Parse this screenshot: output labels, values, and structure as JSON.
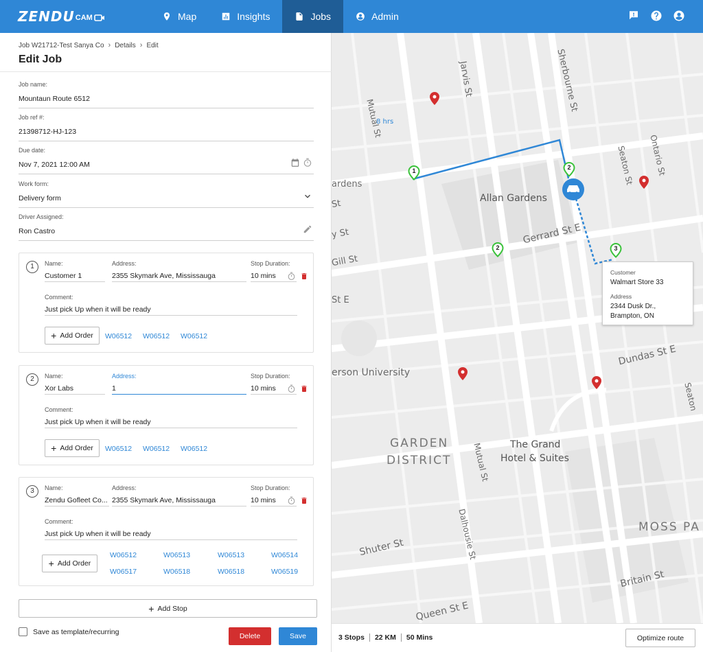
{
  "header": {
    "brand": "ZENDU",
    "brand_suffix": "CAM",
    "nav": [
      {
        "label": "Map",
        "icon": "map-pin-icon"
      },
      {
        "label": "Insights",
        "icon": "bar-chart-icon"
      },
      {
        "label": "Jobs",
        "icon": "document-icon",
        "active": true
      },
      {
        "label": "Admin",
        "icon": "user-circle-icon"
      }
    ],
    "accent": "#2f87d6",
    "active_bg": "#1f5d96"
  },
  "breadcrumb": [
    "Job W21712-Test Sanya Co",
    "Details",
    "Edit"
  ],
  "page_title": "Edit Job",
  "form": {
    "job_name": {
      "label": "Job name:",
      "value": "Mountaun Route 6512"
    },
    "job_ref": {
      "label": "Job ref #:",
      "value": "21398712-HJ-123"
    },
    "due_date": {
      "label": "Due date:",
      "value": "Nov 7, 2021 12:00 AM"
    },
    "work_form": {
      "label": "Work form:",
      "value": "Delivery form"
    },
    "driver": {
      "label": "Driver Assigned:",
      "value": "Ron Castro"
    }
  },
  "stop_labels": {
    "name": "Name:",
    "address": "Address:",
    "duration": "Stop Duration:",
    "comment": "Comment:",
    "add_order": "Add Order"
  },
  "stops": [
    {
      "num": "1",
      "name": "Customer 1",
      "address": "2355 Skymark Ave, Mississauga",
      "duration": "10 mins",
      "comment": "Just pick Up when it will be ready",
      "orders": [
        "W06512",
        "W06512",
        "W06512"
      ]
    },
    {
      "num": "2",
      "name": "Xor Labs",
      "address": "1",
      "duration": "10 mins",
      "comment": "Just pick Up when it will be ready",
      "orders": [
        "W06512",
        "W06512",
        "W06512"
      ]
    },
    {
      "num": "3",
      "name": "Zendu Gofleet Co...",
      "address": "2355 Skymark Ave, Mississauga",
      "duration": "10 mins",
      "comment": "Just pick Up when it will be ready",
      "orders": [
        "W06512",
        "W06513",
        "W06513",
        "W06514",
        "W06517",
        "W06518",
        "W06518",
        "W06519"
      ]
    }
  ],
  "actions": {
    "add_stop": "Add Stop",
    "template": "Save as template/recurring",
    "delete": "Delete",
    "save": "Save",
    "delete_color": "#d32f2f"
  },
  "map": {
    "streets": {
      "jarvis": "Jarvis St",
      "sherbourne": "Sherbourne St",
      "mutual_top": "Mutual St",
      "seaton_top": "Seaton St",
      "ontario": "Ontario St",
      "allan_gardens": "Allan Gardens",
      "gardens": "ardens",
      "st1": "St",
      "y_st": "y St",
      "gill_st": "Gill St",
      "st_e": "St E",
      "gerrard": "Gerrard St E",
      "dundas": "Dundas St E",
      "seaton_bottom": "Seaton",
      "university": "erson University",
      "garden": "GARDEN",
      "district": "DISTRICT",
      "mutual_bottom": "Mutual St",
      "grand1": "The Grand",
      "grand2": "Hotel & Suites",
      "dalhousie": "Dalhousie St",
      "moss": "MOSS PA",
      "shuter": "Shuter St",
      "britain": "Britain St",
      "queen": "Queen St E"
    },
    "route_label": "8 hrs",
    "markers": [
      "1",
      "2",
      "2",
      "3"
    ],
    "popup": {
      "customer_label": "Customer",
      "customer": "Walmart Store 33",
      "address_label": "Address",
      "address_line1": "2344 Dusk Dr.,",
      "address_line2": "Brampton, ON"
    }
  },
  "summary": {
    "stops": "3 Stops",
    "distance": "22 KM",
    "duration": "50 Mins",
    "optimize": "Optimize route"
  }
}
